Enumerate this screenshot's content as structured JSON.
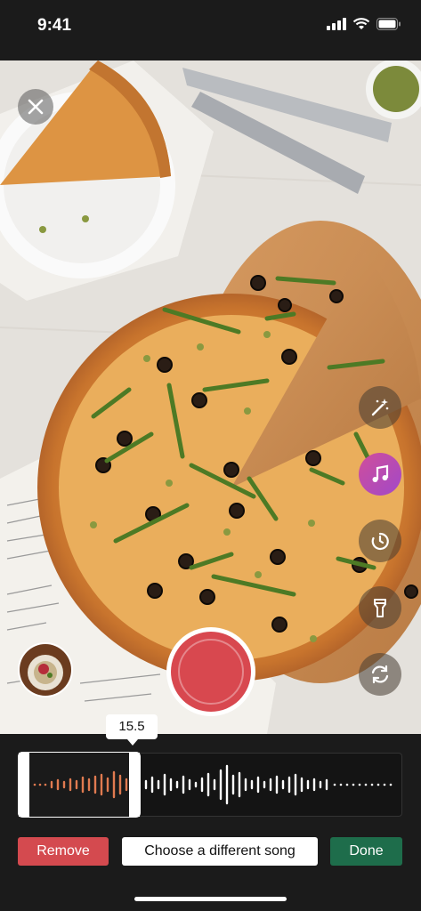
{
  "status": {
    "time": "9:41"
  },
  "recorder": {
    "clip_time": "15.5"
  },
  "icons": {
    "close": "close-icon",
    "effects": "magic-wand-icon",
    "music": "music-note-icon",
    "timer": "timer-icon",
    "flash": "flashlight-icon",
    "flip": "flip-camera-icon"
  },
  "actions": {
    "remove_label": "Remove",
    "choose_label": "Choose a different song",
    "done_label": "Done"
  },
  "colors": {
    "remove": "#d44a4f",
    "done": "#1e6d4b",
    "shutter": "#d8484f",
    "waveform_selected": "#e07a50"
  }
}
